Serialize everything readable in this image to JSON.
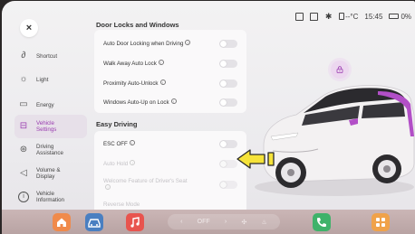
{
  "statusbar": {
    "temp": "--°C",
    "time": "15:45",
    "battery": "0%"
  },
  "sidebar": {
    "items": [
      {
        "label": "Shortcut",
        "icon": "link-icon"
      },
      {
        "label": "Light",
        "icon": "sun-icon"
      },
      {
        "label": "Energy",
        "icon": "battery-icon"
      },
      {
        "label": "Vehicle Settings",
        "icon": "car-icon",
        "active": true
      },
      {
        "label": "Driving Assistance",
        "icon": "steering-icon"
      },
      {
        "label": "Volume & Display",
        "icon": "speaker-icon"
      },
      {
        "label": "Vehicle Information",
        "icon": "info-icon"
      }
    ]
  },
  "sections": {
    "doors": {
      "title": "Door Locks and Windows",
      "rows": [
        {
          "label": "Auto Door Locking when Driving",
          "info": true
        },
        {
          "label": "Walk Away Auto Lock",
          "info": true
        },
        {
          "label": "Proximity Auto-Unlock",
          "info": true
        },
        {
          "label": "Windows Auto-Up on Lock",
          "info": true
        }
      ]
    },
    "driving": {
      "title": "Easy Driving",
      "rows": [
        {
          "label": "ESC OFF",
          "info": true,
          "dim": false
        },
        {
          "label": "Auto Hold",
          "info": true,
          "dim": true
        },
        {
          "label": "Welcome Feature of Driver's Seat",
          "info": true,
          "dim": true
        },
        {
          "label": "Reverse Mode",
          "info": false,
          "dim": true
        }
      ]
    }
  },
  "dock": {
    "center_text": "OFF",
    "colors": {
      "home": "#f08a4b",
      "car": "#4a7fc1",
      "music": "#e8544e",
      "phone": "#3fb26a",
      "apps": "#f0a24a"
    }
  },
  "colors": {
    "accent": "#9a3db0",
    "car_body": "#f4f2f2",
    "car_accent": "#b24fc7"
  }
}
